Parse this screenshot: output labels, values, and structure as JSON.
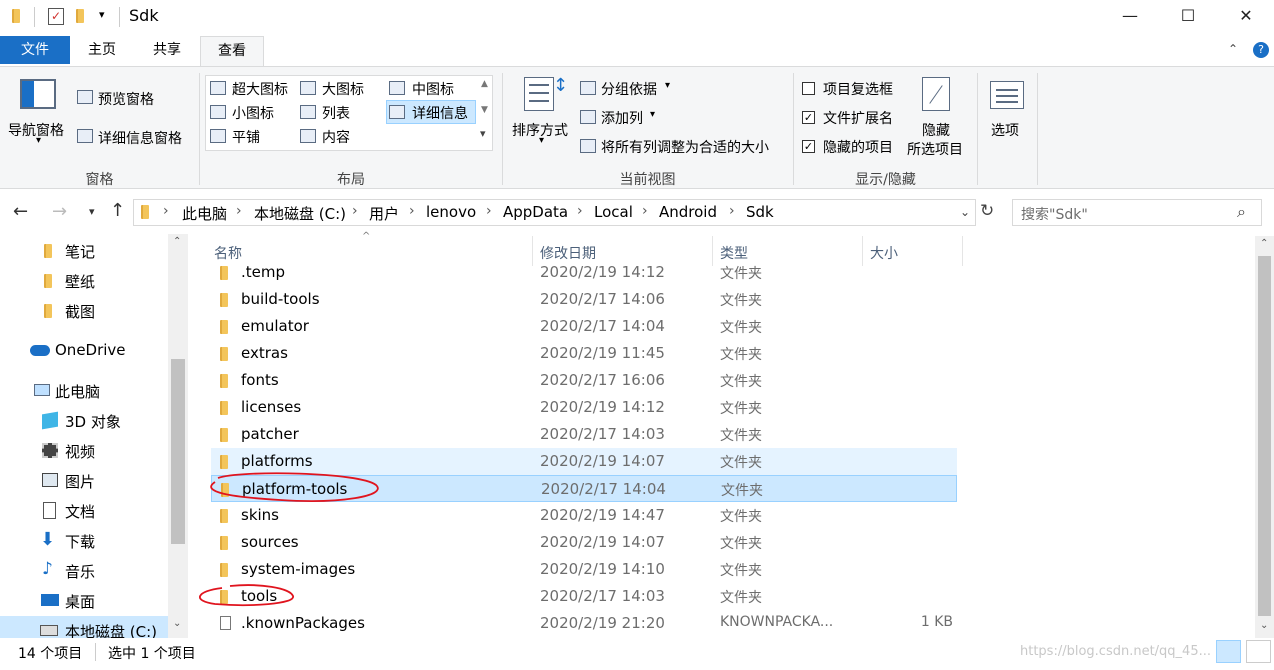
{
  "window": {
    "title": "Sdk",
    "minimize": "—",
    "maximize": "☐",
    "close": "✕"
  },
  "ribbon_tabs": [
    "文件",
    "主页",
    "共享",
    "查看"
  ],
  "ribbon": {
    "panes": {
      "label": "窗格",
      "nav_pane": "导航窗格",
      "preview_pane": "预览窗格",
      "details_pane": "详细信息窗格"
    },
    "layout": {
      "label": "布局",
      "items": [
        "超大图标",
        "大图标",
        "中图标",
        "小图标",
        "列表",
        "详细信息",
        "平铺",
        "内容"
      ]
    },
    "current_view": {
      "label": "当前视图",
      "sort_by": "排序方式",
      "group_by": "分组依据",
      "add_column": "添加列",
      "size_all_columns": "将所有列调整为合适的大小"
    },
    "show_hide": {
      "label": "显示/隐藏",
      "item_checkboxes": "项目复选框",
      "file_extensions": "文件扩展名",
      "hidden_items": "隐藏的项目",
      "hide_selected": "隐藏",
      "hide_selected_2": "所选项目",
      "item_checkboxes_checked": false,
      "file_extensions_checked": true,
      "hidden_items_checked": true
    },
    "options": "选项"
  },
  "address": {
    "breadcrumbs": [
      "此电脑",
      "本地磁盘 (C:)",
      "用户",
      "lenovo",
      "AppData",
      "Local",
      "Android",
      "Sdk"
    ],
    "search_placeholder": "搜索\"Sdk\""
  },
  "nav_pane": {
    "items": [
      "笔记",
      "壁纸",
      "截图",
      "OneDrive",
      "此电脑",
      "3D 对象",
      "视频",
      "图片",
      "文档",
      "下载",
      "音乐",
      "桌面",
      "本地磁盘 (C:)"
    ]
  },
  "columns": {
    "name": "名称",
    "date": "修改日期",
    "type": "类型",
    "size": "大小"
  },
  "files": [
    {
      "name": ".temp",
      "date": "2020/2/19 14:12",
      "type": "文件夹",
      "size": ""
    },
    {
      "name": "build-tools",
      "date": "2020/2/17 14:06",
      "type": "文件夹",
      "size": ""
    },
    {
      "name": "emulator",
      "date": "2020/2/17 14:04",
      "type": "文件夹",
      "size": ""
    },
    {
      "name": "extras",
      "date": "2020/2/19 11:45",
      "type": "文件夹",
      "size": ""
    },
    {
      "name": "fonts",
      "date": "2020/2/17 16:06",
      "type": "文件夹",
      "size": ""
    },
    {
      "name": "licenses",
      "date": "2020/2/19 14:12",
      "type": "文件夹",
      "size": ""
    },
    {
      "name": "patcher",
      "date": "2020/2/17 14:03",
      "type": "文件夹",
      "size": ""
    },
    {
      "name": "platforms",
      "date": "2020/2/19 14:07",
      "type": "文件夹",
      "size": ""
    },
    {
      "name": "platform-tools",
      "date": "2020/2/17 14:04",
      "type": "文件夹",
      "size": ""
    },
    {
      "name": "skins",
      "date": "2020/2/19 14:47",
      "type": "文件夹",
      "size": ""
    },
    {
      "name": "sources",
      "date": "2020/2/19 14:07",
      "type": "文件夹",
      "size": ""
    },
    {
      "name": "system-images",
      "date": "2020/2/19 14:10",
      "type": "文件夹",
      "size": ""
    },
    {
      "name": "tools",
      "date": "2020/2/17 14:03",
      "type": "文件夹",
      "size": ""
    },
    {
      "name": ".knownPackages",
      "date": "2020/2/19 21:20",
      "type": "KNOWNPACKA...",
      "size": "1 KB"
    }
  ],
  "status": {
    "count": "14 个项目",
    "selected": "选中 1 个项目"
  },
  "watermark": "https://blog.csdn.net/qq_45..."
}
